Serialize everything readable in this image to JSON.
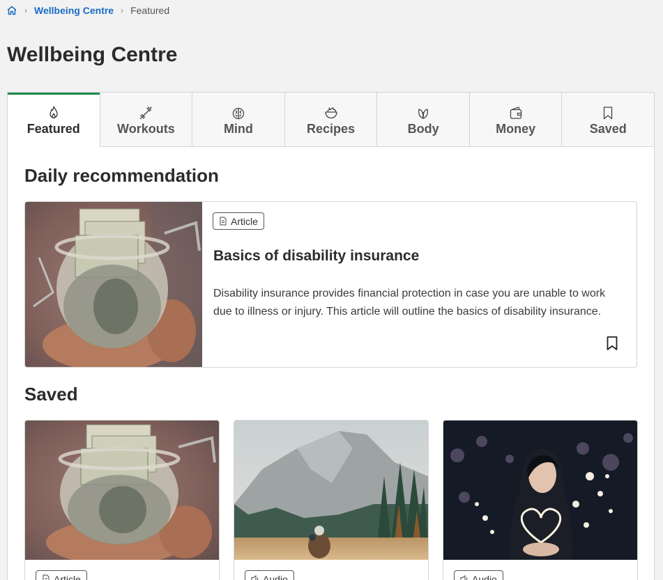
{
  "breadcrumb": {
    "home_icon": "home-icon",
    "link": "Wellbeing Centre",
    "current": "Featured"
  },
  "page": {
    "title": "Wellbeing Centre"
  },
  "colors": {
    "accent": "#1f8a4c",
    "link": "#1a6bc4",
    "background": "#f2f2f2"
  },
  "tabs": [
    {
      "label": "Featured",
      "icon": "flame-icon",
      "active": true
    },
    {
      "label": "Workouts",
      "icon": "dumbbell-icon",
      "active": false
    },
    {
      "label": "Mind",
      "icon": "brain-icon",
      "active": false
    },
    {
      "label": "Recipes",
      "icon": "salad-bowl-icon",
      "active": false
    },
    {
      "label": "Body",
      "icon": "leaf-icon",
      "active": false
    },
    {
      "label": "Money",
      "icon": "wallet-icon",
      "active": false
    },
    {
      "label": "Saved",
      "icon": "bookmark-icon",
      "active": false
    }
  ],
  "daily": {
    "heading": "Daily recommendation",
    "badge": "Article",
    "badge_icon": "document-icon",
    "title": "Basics of disability insurance",
    "description": "Disability insurance provides financial protection in case you are unable to work due to illness or injury. This article will outline the basics of disability insurance.",
    "image": "money-jar-image"
  },
  "saved": {
    "heading": "Saved",
    "items": [
      {
        "badge": "Article",
        "badge_icon": "document-icon",
        "image": "money-jar-image"
      },
      {
        "badge": "Audio",
        "badge_icon": "speaker-icon",
        "image": "mountain-landscape-image"
      },
      {
        "badge": "Audio",
        "badge_icon": "speaker-icon",
        "image": "woman-with-lights-image"
      }
    ]
  }
}
